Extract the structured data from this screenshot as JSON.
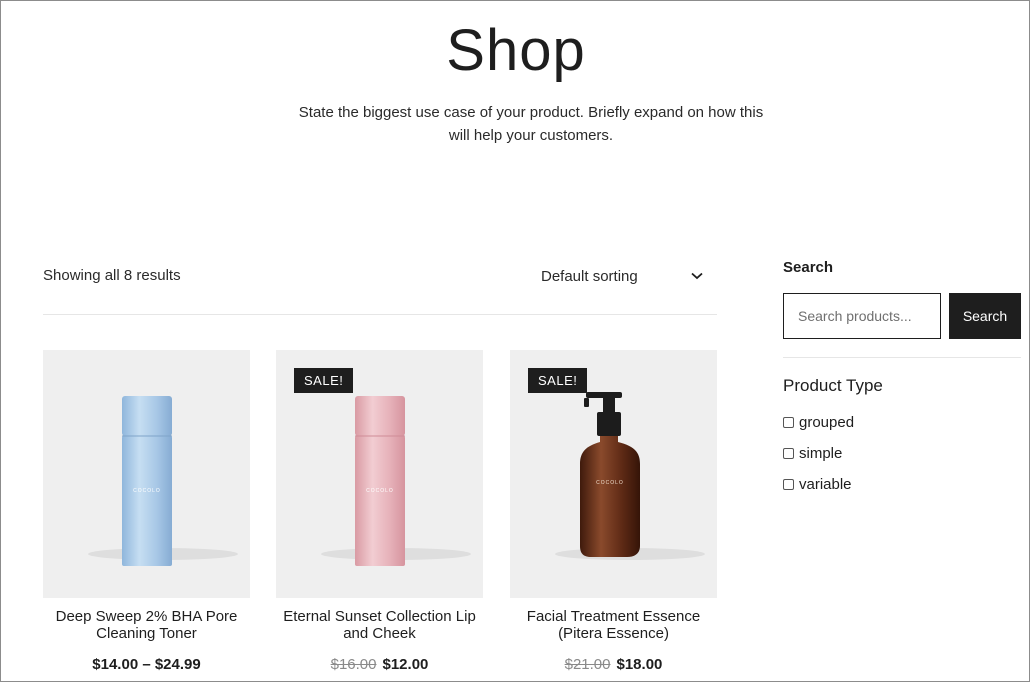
{
  "page": {
    "title": "Shop",
    "description": "State the biggest use case of your product. Briefly expand on how this will help your customers."
  },
  "toolbar": {
    "result_count": "Showing all 8 results",
    "sort_selected": "Default sorting"
  },
  "products": [
    {
      "name": "Deep Sweep 2% BHA Pore Cleaning Toner",
      "price": "$14.00 – $24.99",
      "old_price": "",
      "sale": false,
      "bottle_color": "#a9c9e6",
      "image_label": "COCOLO"
    },
    {
      "name": "Eternal Sunset Collection Lip and Cheek",
      "price": "$12.00",
      "old_price": "$16.00",
      "sale": true,
      "bottle_color": "#e8b6bd",
      "image_label": "COCOLO"
    },
    {
      "name": "Facial Treatment Essence (Pitera Essence)",
      "price": "$18.00",
      "old_price": "$21.00",
      "sale": true,
      "bottle_color": "#6b3420",
      "image_label": "COCOLO"
    }
  ],
  "sale_badge": "SALE!",
  "sidebar": {
    "search_heading": "Search",
    "search_placeholder": "Search products...",
    "search_button": "Search",
    "product_type_heading": "Product Type",
    "product_types": [
      "grouped",
      "simple",
      "variable"
    ]
  },
  "colors": {
    "primary": "#1e1e1e",
    "image_background": "#efefef",
    "muted_price": "#8a8a8a"
  },
  "icons": {
    "sort": "chevron-down-icon"
  }
}
